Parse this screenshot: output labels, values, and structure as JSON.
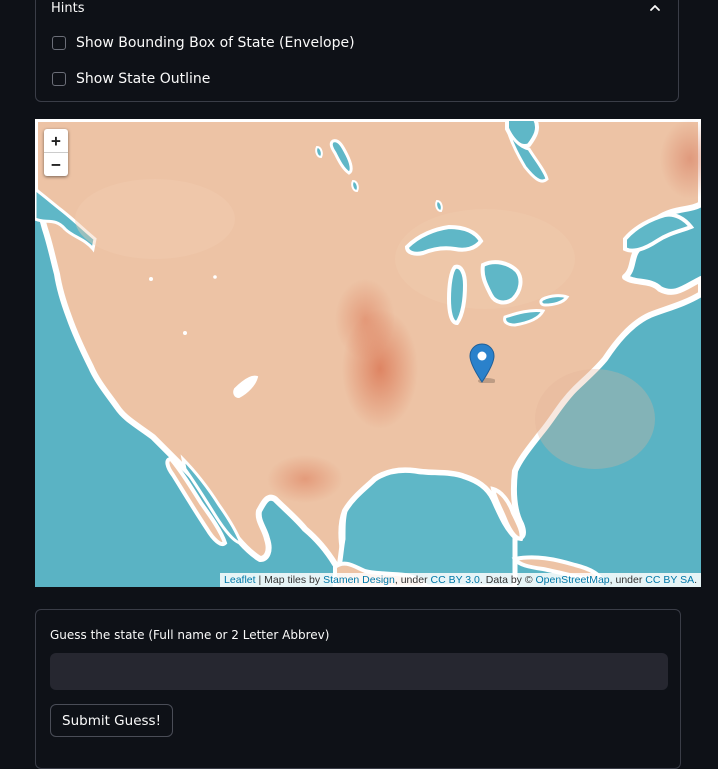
{
  "hints": {
    "title": "Hints",
    "options": [
      {
        "label": "Show Bounding Box of State (Envelope)",
        "checked": false
      },
      {
        "label": "Show State Outline",
        "checked": false
      }
    ]
  },
  "map": {
    "zoom_in": "+",
    "zoom_out": "−",
    "tile_style": "watercolor",
    "colors": {
      "water": "#5fb7c7",
      "land": "#edc3a5",
      "coast": "#ffffff",
      "marker": "#2a81cb"
    },
    "attribution": {
      "leaflet": "Leaflet",
      "sep": " | Map tiles by ",
      "stamen": "Stamen Design",
      "under1": ", under ",
      "cc_by": "CC BY 3.0",
      "data_by": ". Data by © ",
      "osm": "OpenStreetMap",
      "under2": ", under ",
      "cc_by_sa": "CC BY SA",
      "end": "."
    }
  },
  "guess": {
    "label": "Guess the state (Full name or 2 Letter Abbrev)",
    "value": "",
    "placeholder": "",
    "submit": "Submit Guess!"
  }
}
